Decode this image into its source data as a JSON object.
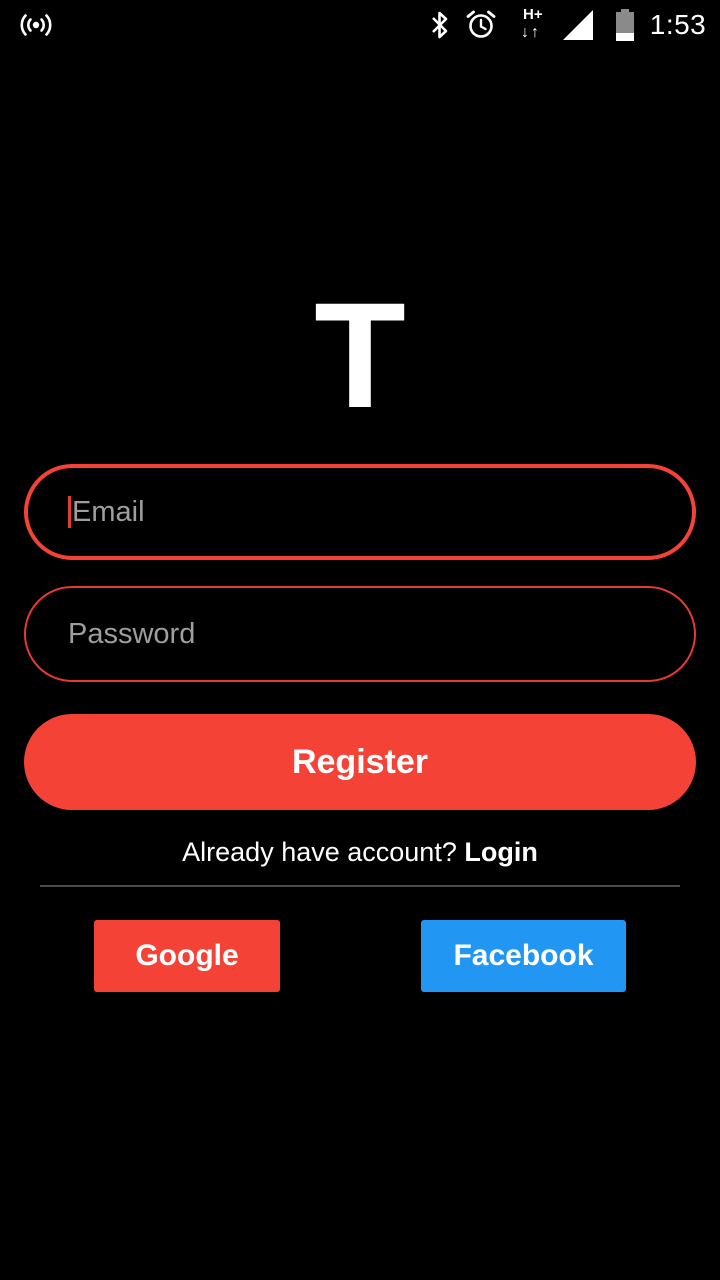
{
  "status_bar": {
    "time": "1:53",
    "network_type": "H+",
    "network_arrows": "↓↑",
    "icons": [
      "hotspot-icon",
      "bluetooth-icon",
      "alarm-icon",
      "network-type-icon",
      "signal-icon",
      "battery-icon"
    ]
  },
  "logo": {
    "letter": "T"
  },
  "form": {
    "email_placeholder": "Email",
    "email_value": "",
    "password_placeholder": "Password",
    "password_value": "",
    "register_label": "Register"
  },
  "login_prompt": {
    "text": "Already have account? ",
    "link": "Login"
  },
  "social": {
    "google_label": "Google",
    "facebook_label": "Facebook"
  },
  "colors": {
    "background": "#000000",
    "accent": "#f44336",
    "facebook": "#2196f3",
    "placeholder": "#9e9e9e",
    "text": "#ffffff"
  }
}
